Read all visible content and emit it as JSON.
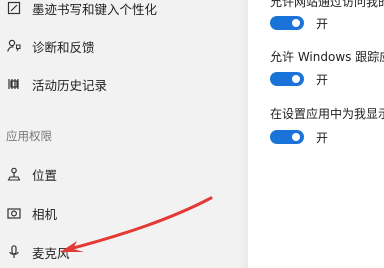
{
  "sidebar": {
    "items": [
      {
        "label": "墨迹书写和键入个性化",
        "icon": "pen-icon"
      },
      {
        "label": "诊断和反馈",
        "icon": "feedback-icon"
      },
      {
        "label": "活动历史记录",
        "icon": "activity-history-icon"
      },
      {
        "label": "位置",
        "icon": "location-icon"
      },
      {
        "label": "相机",
        "icon": "camera-icon"
      },
      {
        "label": "麦克风",
        "icon": "microphone-icon"
      }
    ],
    "section_heading": "应用权限"
  },
  "content": {
    "settings": [
      {
        "text": "允许网站通过访问我的语",
        "toggle_state": "开",
        "on": true
      },
      {
        "text": "允许 Windows 跟踪应用",
        "toggle_state": "开",
        "on": true
      },
      {
        "text": "在设置应用中为我显示建",
        "toggle_state": "开",
        "on": true
      }
    ]
  },
  "colors": {
    "accent": "#1a73d9",
    "arrow": "#e53935",
    "sidebar_bg": "#f2f2f2",
    "content_bg": "#ffffff"
  }
}
